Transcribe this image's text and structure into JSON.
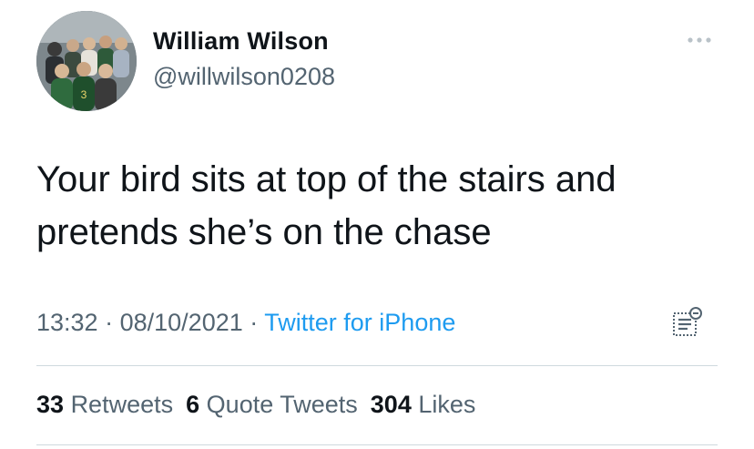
{
  "author": {
    "display_name": "William Wilson",
    "handle": "@willwilson0208"
  },
  "tweet": {
    "text_line1": "Your bird sits at top of the stairs and",
    "text_line2": "pretends she’s on the chase"
  },
  "meta": {
    "time": "13:32",
    "separator": "·",
    "date": "08/10/2021",
    "source": "Twitter for iPhone"
  },
  "stats": {
    "retweets_count": "33",
    "retweets_label": "Retweets",
    "quotes_count": "6",
    "quotes_label": "Quote Tweets",
    "likes_count": "304",
    "likes_label": "Likes"
  },
  "icons": {
    "more": "more-horizontal-icon",
    "analytics": "analytics-icon"
  },
  "colors": {
    "text": "#0f1419",
    "secondary": "#536471",
    "link": "#1d9bf0",
    "divider": "#cfd9de"
  }
}
